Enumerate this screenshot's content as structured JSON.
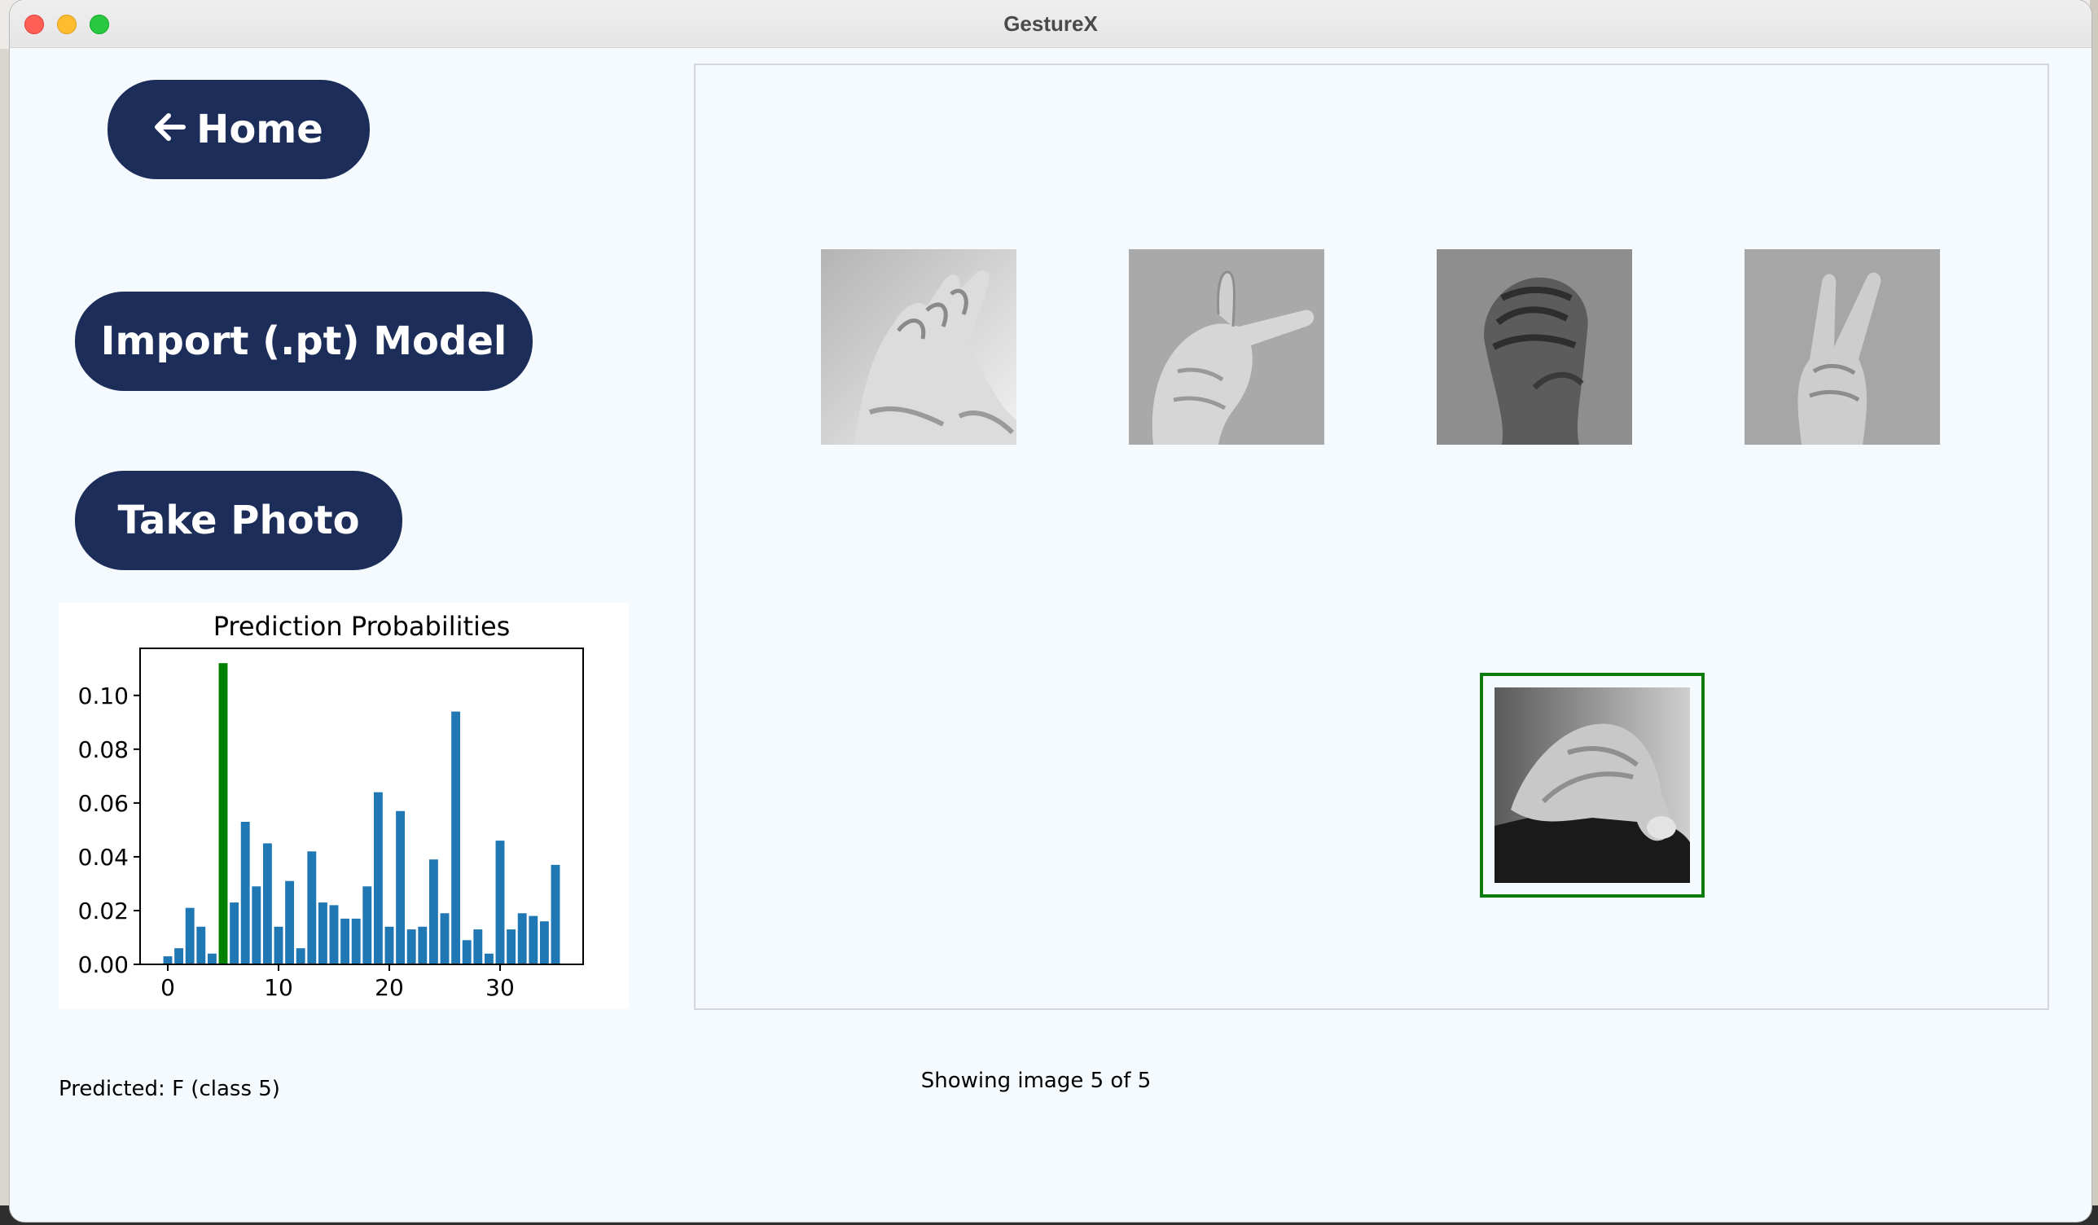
{
  "window": {
    "title": "GestureX"
  },
  "sidebar": {
    "home_label": "Home",
    "import_label": "Import (.pt) Model",
    "photo_label": "Take Photo",
    "predicted_text": "Predicted: F (class 5)"
  },
  "gallery": {
    "status_text": "Showing image 5 of 5",
    "selected_index": 5,
    "images": [
      {
        "index": 1,
        "depicts": "hand-sign-open-fingers"
      },
      {
        "index": 2,
        "depicts": "hand-sign-pointing-sideways"
      },
      {
        "index": 3,
        "depicts": "hand-sign-fist"
      },
      {
        "index": 4,
        "depicts": "hand-sign-v"
      },
      {
        "index": 5,
        "depicts": "hand-sign-pinch"
      }
    ]
  },
  "colors": {
    "button": "#1b2d58",
    "window_bg": "#f5faff",
    "bar": "#1f77b4",
    "bar_highlight": "#008000",
    "selection": "#0b7a0b"
  },
  "chart_data": {
    "type": "bar",
    "title": "Prediction Probabilities",
    "xlabel": "",
    "ylabel": "",
    "xlim": [
      -2.5,
      37.5
    ],
    "ylim": [
      0,
      0.1175
    ],
    "xticks": [
      0,
      10,
      20,
      30
    ],
    "yticks": [
      0.0,
      0.02,
      0.04,
      0.06,
      0.08,
      0.1
    ],
    "ytick_labels": [
      "0.00",
      "0.02",
      "0.04",
      "0.06",
      "0.08",
      "0.10"
    ],
    "grid": false,
    "highlight_index": 5,
    "categories": [
      0,
      1,
      2,
      3,
      4,
      5,
      6,
      7,
      8,
      9,
      10,
      11,
      12,
      13,
      14,
      15,
      16,
      17,
      18,
      19,
      20,
      21,
      22,
      23,
      24,
      25,
      26,
      27,
      28,
      29,
      30,
      31,
      32,
      33,
      34,
      35
    ],
    "values": [
      0.003,
      0.006,
      0.021,
      0.014,
      0.004,
      0.112,
      0.023,
      0.053,
      0.029,
      0.045,
      0.014,
      0.031,
      0.006,
      0.042,
      0.023,
      0.022,
      0.017,
      0.017,
      0.029,
      0.064,
      0.014,
      0.057,
      0.013,
      0.014,
      0.039,
      0.019,
      0.094,
      0.009,
      0.013,
      0.004,
      0.046,
      0.013,
      0.019,
      0.018,
      0.016,
      0.037
    ]
  }
}
